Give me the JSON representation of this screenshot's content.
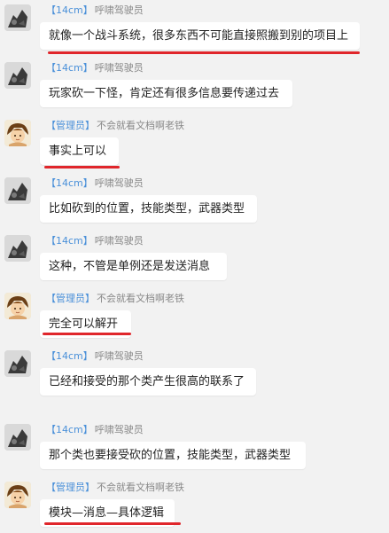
{
  "users": {
    "member": {
      "tag": "【14cm】",
      "nick": "呼啸驾驶员"
    },
    "admin": {
      "tag": "【管理员】",
      "nick": "不会就看文档啊老铁"
    }
  },
  "messages": [
    {
      "text": "就像一个战斗系统，很多东西不可能直接照搬到别的项目上",
      "underlined": true
    },
    {
      "text": "玩家砍一下怪，肯定还有很多信息要传递过去",
      "underlined": false
    },
    {
      "text": "事实上可以",
      "underlined": true
    },
    {
      "text": "比如砍到的位置，技能类型，武器类型",
      "underlined": false
    },
    {
      "text": "这种，不管是单例还是发送消息",
      "underlined": false
    },
    {
      "text": "完全可以解开",
      "underlined": true
    },
    {
      "text": "已经和接受的那个类产生很高的联系了",
      "underlined": false
    },
    {
      "text": "那个类也要接受砍的位置，技能类型，武器类型",
      "underlined": false
    },
    {
      "text": "模块—消息—具体逻辑",
      "underlined": true
    }
  ],
  "colors": {
    "underline": "#e0262b",
    "tag": "#4a90d9",
    "nick": "#888888"
  }
}
